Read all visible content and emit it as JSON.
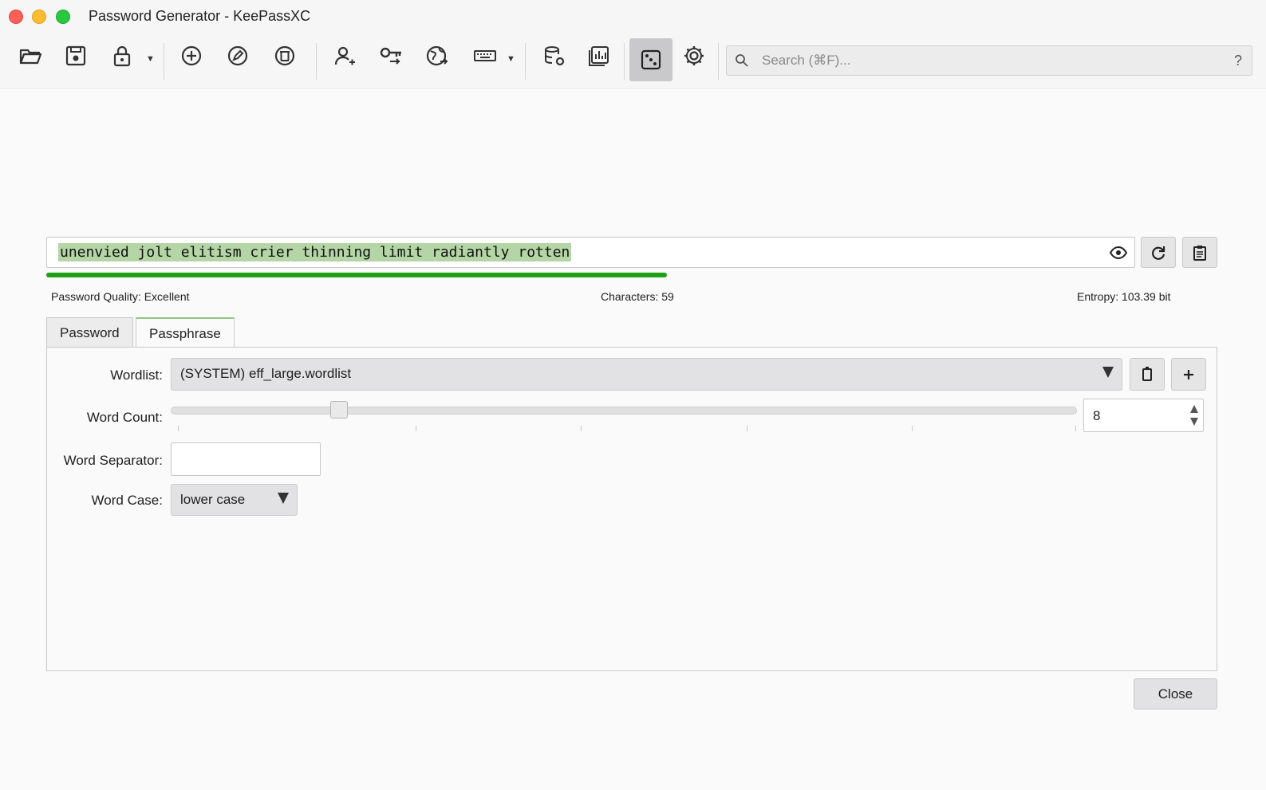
{
  "window": {
    "title": "Password Generator - KeePassXC"
  },
  "toolbar": {
    "icons": [
      "open-folder-icon",
      "save-icon",
      "lock-icon",
      "add-entry-icon",
      "edit-entry-icon",
      "delete-entry-icon",
      "copy-username-icon",
      "copy-password-icon",
      "copy-url-icon",
      "autotype-keyboard-icon",
      "database-settings-icon",
      "database-reports-icon",
      "password-generator-icon",
      "settings-gear-icon"
    ],
    "search_placeholder": "Search (⌘F)...",
    "help_label": "?"
  },
  "generator": {
    "password": "unenvied jolt elitism crier thinning limit radiantly rotten",
    "quality_label": "Password Quality: Excellent",
    "quality_fraction": 0.53,
    "characters_label": "Characters: 59",
    "entropy_label": "Entropy: 103.39 bit"
  },
  "tabs": [
    {
      "label": "Password",
      "active": false
    },
    {
      "label": "Passphrase",
      "active": true
    }
  ],
  "passphrase": {
    "wordlist_label": "Wordlist:",
    "wordlist_value": "(SYSTEM) eff_large.wordlist",
    "word_count_label": "Word Count:",
    "word_count_value": "8",
    "word_count_min": 1,
    "word_count_max": 40,
    "word_separator_label": "Word Separator:",
    "word_separator_value": "",
    "word_case_label": "Word Case:",
    "word_case_value": "lower case"
  },
  "footer": {
    "close_label": "Close"
  },
  "colors": {
    "quality_bar": "#1ca114",
    "selection": "#b4d5a5",
    "active_tab_accent": "#8fc583"
  }
}
